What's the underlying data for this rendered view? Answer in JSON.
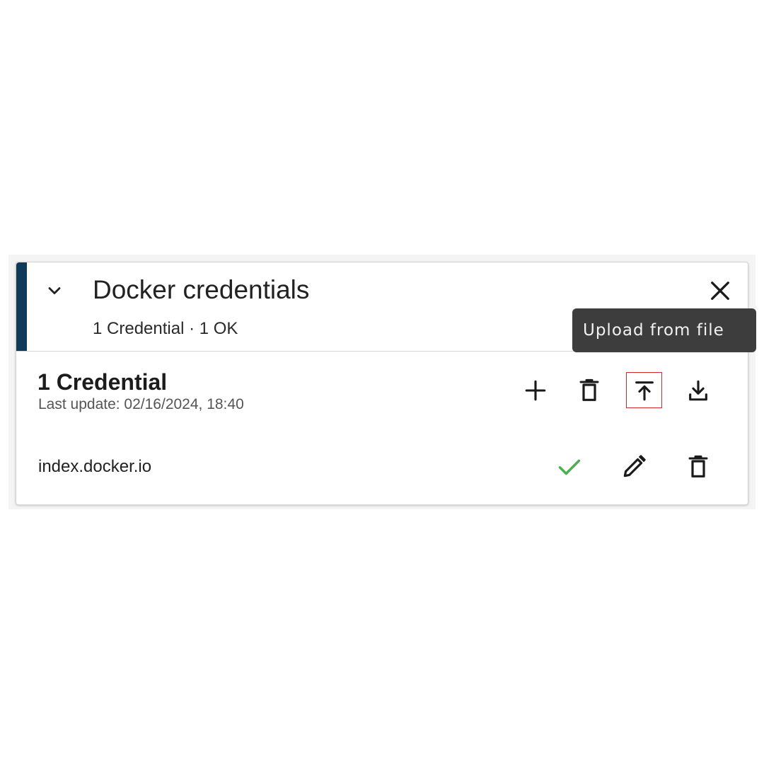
{
  "panel": {
    "title": "Docker credentials",
    "subtitle": "1 Credential · 1 OK",
    "accent_color": "#0f3a58",
    "expand_icon": "chevron-down-icon",
    "close_icon": "close-icon"
  },
  "credentials": {
    "heading": "1 Credential",
    "last_update": "Last update: 02/16/2024, 18:40",
    "toolbar": [
      {
        "icon": "add-icon",
        "action": "add"
      },
      {
        "icon": "delete-icon",
        "action": "delete"
      },
      {
        "icon": "upload-icon",
        "action": "upload",
        "focused": true
      },
      {
        "icon": "download-icon",
        "action": "download"
      }
    ],
    "items": [
      {
        "host": "index.docker.io",
        "status_icon": "check-icon",
        "status_color": "#4caf50",
        "actions": [
          "edit-icon",
          "delete-icon"
        ]
      }
    ]
  },
  "tooltip": {
    "text": "Upload from file"
  }
}
